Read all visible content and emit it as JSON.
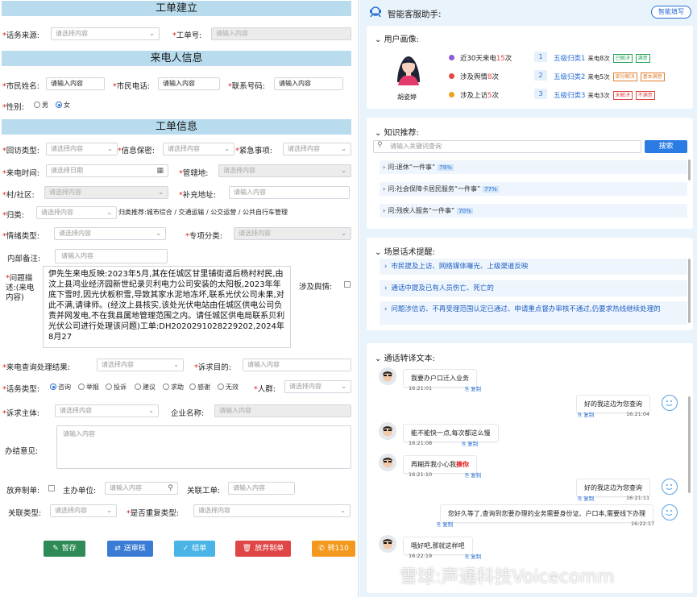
{
  "sections": {
    "create": "工单建立",
    "caller": "来电人信息",
    "info": "工单信息"
  },
  "create": {
    "source_label": "话务来源:",
    "source_ph": "请选择内容",
    "no_label": "工单号:",
    "no_ph": "请输入内容"
  },
  "caller": {
    "name_label": "市民姓名:",
    "name_ph": "请输入内容",
    "phone_label": "市民电话:",
    "phone_ph": "请输入内容",
    "contact_label": "联系号码:",
    "contact_ph": "请输入内容",
    "gender_label": "性别:",
    "male": "男",
    "female": "女"
  },
  "info": {
    "visit_type": "回访类型:",
    "visit_ph": "请选择内容",
    "secret": "信息保密:",
    "secret_ph": "请选择内容",
    "urgent": "紧急事项:",
    "urgent_ph": "请选择内容",
    "time": "来电时间:",
    "time_ph": "请选择日期",
    "area": "管辖地:",
    "area_ph": "请选择内容",
    "village": "村/社区:",
    "village_ph": "请选择内容",
    "addr": "补充地址:",
    "addr_ph": "请输入内容",
    "category": "归类:",
    "category_ph": "请选择内容",
    "category_rec": "归类推荐:城市综合 / 交通运输 / 公交运营 / 公共自行车管理",
    "mood": "情绪类型:",
    "mood_ph": "请选择内容",
    "special": "专项分类:",
    "special_ph": "请选择内容",
    "remark": "内部备注:",
    "remark_ph": "请输入内容",
    "problem_label": "问题描述:(来电内容)",
    "problem_text": "伊先生来电反映:2023年5月,其在任城区甘里铺街道后杨村村民,由汶上县鸿业经济园新世纪录贝利电力公司安装的太阳板,2023年年底下雪时,因光伏板积雪,导致其家水泥地冻坏,联系光伏公司未果,对此不满,请律师。(经汶上县核实,该处光伏电站由任城区供电公司负责并网发电,不在我县属地管理范围之内。请任城区供电局联系贝利光伏公司进行处理该问题)工单:DH2020291028229202,2024年8月27",
    "public_opinion": "涉及舆情:",
    "result": "来电查询处理结果:",
    "result_ph": "请选择内容",
    "purpose": "诉求目的:",
    "purpose_ph": "请输入内容",
    "call_type": "话务类型:",
    "call_types": [
      "咨询",
      "举报",
      "投诉",
      "建议",
      "求助",
      "感谢",
      "无效"
    ],
    "crowd": "人群:",
    "crowd_ph": "请选择内容",
    "subject": "诉求主体:",
    "subject_ph": "请选择内容",
    "company": "企业名称:",
    "company_ph": "请输入内容",
    "opinion": "办结意见:",
    "opinion_ph": "请输入内容",
    "abandon": "放弃制单:",
    "host": "主办单位:",
    "host_ph": "请输入内容",
    "relate": "关联工单:",
    "relate_ph": "请输入内容",
    "relate_type": "关联类型:",
    "relate_type_ph": "请选择内容",
    "repeat": "是否重复类型:",
    "repeat_ph": "请选择内容"
  },
  "buttons": [
    {
      "label": "暂存",
      "icon": "✎",
      "color": "#2e8b57"
    },
    {
      "label": "送审核",
      "icon": "⇄",
      "color": "#3a7bd5"
    },
    {
      "label": "结单",
      "icon": "✓",
      "color": "#4bb4e6"
    },
    {
      "label": "放弃制单",
      "icon": "🗑",
      "color": "#e04646"
    },
    {
      "label": "转110",
      "icon": "✆",
      "color": "#f39a1e"
    }
  ],
  "assistant": {
    "title": "智能客服助手:",
    "fill_btn": "智能填写",
    "profile_title": "用户画像:",
    "user_name": "胡姿婷",
    "stats": [
      {
        "pre": "近30天来电",
        "num": "15",
        "post": "次",
        "dot": "#8e5bd8"
      },
      {
        "pre": "涉及舆情",
        "num": "8",
        "post": "次",
        "dot": "#e64545"
      },
      {
        "pre": "涉及上访",
        "num": "5",
        "post": "次",
        "dot": "#f0a020"
      }
    ],
    "classes": [
      {
        "n": "1",
        "name": "五级归类1",
        "cnt": "来电8次",
        "t1": "已解决",
        "t2": "满意",
        "c1": "#2aa45a",
        "c2": "#2aa45a"
      },
      {
        "n": "2",
        "name": "五级归类2",
        "cnt": "来电5次",
        "t1": "部分解决",
        "t2": "基本满意",
        "c1": "#e08030",
        "c2": "#e08030"
      },
      {
        "n": "3",
        "name": "五级归类3",
        "cnt": "来电3次",
        "t1": "未解决",
        "t2": "不满意",
        "c1": "#e04646",
        "c2": "#e04646"
      }
    ],
    "knowledge_title": "知识推荐:",
    "kn_ph": "请输入关键词查询",
    "search_btn": "搜索",
    "knowledge": [
      {
        "q": "问:退休“一件事”",
        "pct": "79%"
      },
      {
        "q": "问:社会保障卡居民服务“一件事”",
        "pct": "77%"
      },
      {
        "q": "问:残疾人服务“一件事”",
        "pct": "70%"
      }
    ],
    "scene_title": "场景话术提醒:",
    "scenes": [
      "市民提及上访、网络媒体曝光、上级渠道反映",
      "通话中提及已有人员伤亡、死亡的",
      "问题涉信访、不再受理范围认定已通过、申请重点督办审核不通过,仍要求热线继续处理的"
    ],
    "transcript_title": "通话转译文本:",
    "copy": "复制",
    "msgs": [
      {
        "side": "L",
        "text": "我要办户口迁入业务",
        "time": "16:21:01"
      },
      {
        "side": "R",
        "text": "好的我这边为您查询",
        "time": "16:21:04"
      },
      {
        "side": "L",
        "text": "能不能快一点,每次都这么慢",
        "time": "16:21:08"
      },
      {
        "side": "L",
        "text": "再糊弄我小心我",
        "em": "揍你",
        "time": "16:21:10"
      },
      {
        "side": "R",
        "text": "好的我这边为您查询",
        "time": "16:21:11"
      },
      {
        "side": "R",
        "text": "您好久等了,查询到您要办理的业务需要身份证、户口本,需要线下办理",
        "time": "16:22:17"
      },
      {
        "side": "L",
        "text": "哦好吧,那就这样吧",
        "time": "16:22:19"
      }
    ],
    "watermark": "雪球:声通科技Voicecomm"
  }
}
